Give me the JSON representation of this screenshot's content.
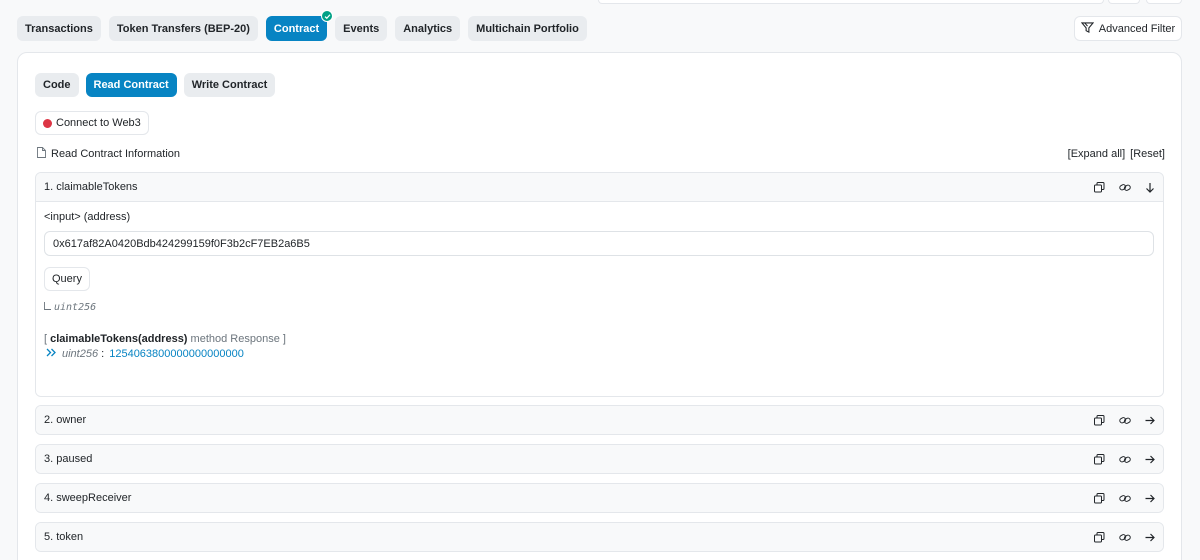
{
  "tabs": [
    {
      "label": "Transactions",
      "active": false
    },
    {
      "label": "Token Transfers (BEP-20)",
      "active": false
    },
    {
      "label": "Contract",
      "active": true
    },
    {
      "label": "Events",
      "active": false
    },
    {
      "label": "Analytics",
      "active": false
    },
    {
      "label": "Multichain Portfolio",
      "active": false
    }
  ],
  "advanced_filter": {
    "label": "Advanced Filter",
    "icon": "filter-icon"
  },
  "subtabs": [
    {
      "label": "Code"
    },
    {
      "label": "Read Contract"
    },
    {
      "label": "Write Contract"
    }
  ],
  "connect_web3": {
    "label": "Connect to Web3",
    "status_color": "#dc3545"
  },
  "info": {
    "title": "Read Contract Information",
    "expand_all": "[Expand all]",
    "reset": "[Reset]"
  },
  "methods": [
    {
      "title": "1. claimableTokens",
      "expanded": true,
      "input_label": "<input> (address)",
      "input_value": "0x617af82A0420Bdb424299159f0F3b2cF7EB2a6B5",
      "query_label": "Query",
      "return_type": "uint256",
      "response_prefix": "[ ",
      "response_method": "claimableTokens(address)",
      "response_suffix": " method Response ]",
      "response_type": "uint256",
      "response_sep": " :",
      "response_value": "1254063800000000000000"
    },
    {
      "title": "2. owner",
      "expanded": false
    },
    {
      "title": "3. paused",
      "expanded": false
    },
    {
      "title": "4. sweepReceiver",
      "expanded": false
    },
    {
      "title": "5. token",
      "expanded": false
    }
  ],
  "colors": {
    "accent": "#0784c3",
    "success": "#00a186",
    "danger": "#dc3545"
  }
}
